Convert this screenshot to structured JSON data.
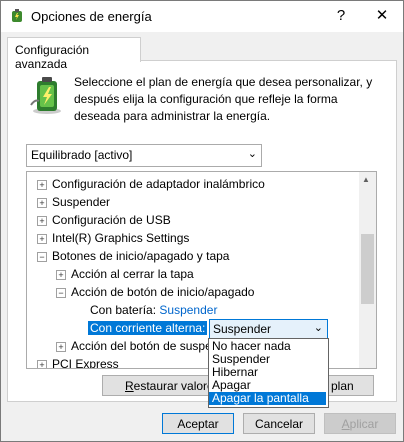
{
  "window": {
    "title": "Opciones de energía",
    "help": "?",
    "close": "✕"
  },
  "tab": {
    "label": "Configuración avanzada"
  },
  "description": "Seleccione el plan de energía que desea personalizar, y después elija la configuración que refleje la forma deseada para administrar la energía.",
  "plan_select": {
    "value": "Equilibrado [activo]"
  },
  "tree": {
    "items": [
      {
        "label": "Configuración de adaptador inalámbrico",
        "expander": "+"
      },
      {
        "label": "Suspender",
        "expander": "+"
      },
      {
        "label": "Configuración de USB",
        "expander": "+"
      },
      {
        "label": "Intel(R) Graphics Settings",
        "expander": "+"
      },
      {
        "label": "Botones de inicio/apagado y tapa",
        "expander": "−"
      },
      {
        "label": "Acción al cerrar la tapa",
        "expander": "+"
      },
      {
        "label": "Acción de botón de inicio/apagado",
        "expander": "−"
      },
      {
        "label": "Con batería:",
        "value": "Suspender"
      },
      {
        "label": "Con corriente alterna:"
      },
      {
        "label": "Acción del botón de suspe",
        "expander": "+"
      },
      {
        "label": "PCI Express",
        "expander": "+"
      }
    ]
  },
  "combo": {
    "value": "Suspender"
  },
  "dropdown": {
    "options": [
      "No hacer nada",
      "Suspender",
      "Hibernar",
      "Apagar",
      "Apagar la pantalla"
    ],
    "selected_index": 4
  },
  "buttons": {
    "restore_prefix": "R",
    "restore_rest": "estaurar valore",
    "restore_suffix": "plan",
    "accept": "Aceptar",
    "cancel": "Cancelar",
    "apply_prefix": "A",
    "apply_rest": "plicar"
  }
}
